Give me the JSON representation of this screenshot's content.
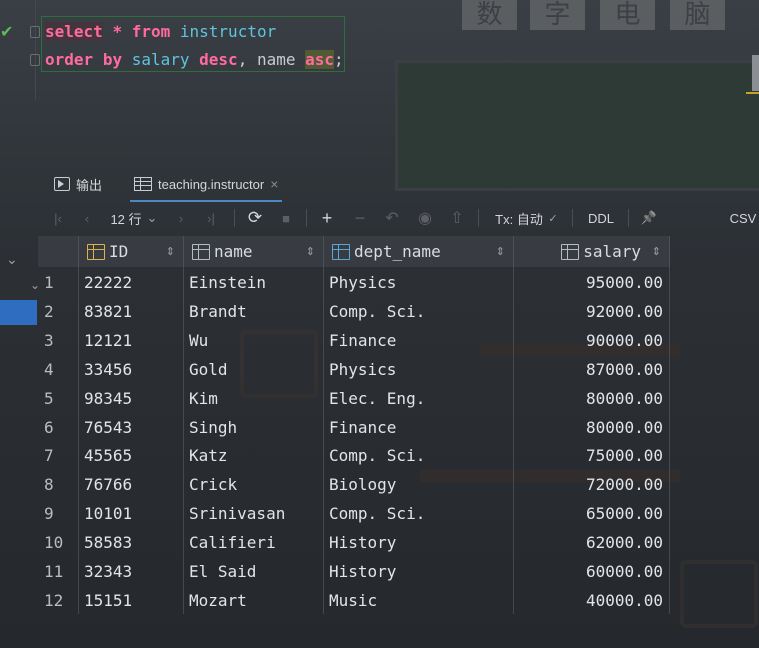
{
  "editor": {
    "line1": {
      "select": "select",
      "star": "*",
      "from": "from",
      "table": "instructor"
    },
    "line2": {
      "order": "order",
      "by": "by",
      "col1": "salary",
      "desc": "desc",
      "comma": ",",
      "col2": "name",
      "asc": "asc",
      "semi": ";"
    }
  },
  "tabs": [
    {
      "label": "输出",
      "icon": "run-output-icon"
    },
    {
      "label": "teaching.instructor",
      "icon": "table-grid-icon",
      "close": "×"
    }
  ],
  "toolbar": {
    "first": "|‹",
    "prev": "‹",
    "rows": "12 行",
    "rows_caret": "⌄",
    "next": "›",
    "last": "›|",
    "refresh": "⟳",
    "stop": "■",
    "add": "+",
    "remove": "−",
    "revert": "↶",
    "preview": "◉",
    "submit": "⇧",
    "tx": "Tx: 自动",
    "tx_caret": "✓",
    "ddl": "DDL",
    "pin": "📌",
    "csv": "CSV"
  },
  "table": {
    "columns": [
      {
        "name": "ID",
        "icon": "primary-key-icon"
      },
      {
        "name": "name",
        "icon": "column-icon"
      },
      {
        "name": "dept_name",
        "icon": "foreign-key-icon"
      },
      {
        "name": "salary",
        "icon": "column-icon"
      }
    ],
    "rows": [
      {
        "n": "1",
        "id": "22222",
        "name": "Einstein",
        "dept": "Physics",
        "salary": "95000.00"
      },
      {
        "n": "2",
        "id": "83821",
        "name": "Brandt",
        "dept": "Comp. Sci.",
        "salary": "92000.00"
      },
      {
        "n": "3",
        "id": "12121",
        "name": "Wu",
        "dept": "Finance",
        "salary": "90000.00"
      },
      {
        "n": "4",
        "id": "33456",
        "name": "Gold",
        "dept": "Physics",
        "salary": "87000.00"
      },
      {
        "n": "5",
        "id": "98345",
        "name": "Kim",
        "dept": "Elec. Eng.",
        "salary": "80000.00"
      },
      {
        "n": "6",
        "id": "76543",
        "name": "Singh",
        "dept": "Finance",
        "salary": "80000.00"
      },
      {
        "n": "7",
        "id": "45565",
        "name": "Katz",
        "dept": "Comp. Sci.",
        "salary": "75000.00"
      },
      {
        "n": "8",
        "id": "76766",
        "name": "Crick",
        "dept": "Biology",
        "salary": "72000.00"
      },
      {
        "n": "9",
        "id": "10101",
        "name": "Srinivasan",
        "dept": "Comp. Sci.",
        "salary": "65000.00"
      },
      {
        "n": "10",
        "id": "58583",
        "name": "Califieri",
        "dept": "History",
        "salary": "62000.00"
      },
      {
        "n": "11",
        "id": "32343",
        "name": "El Said",
        "dept": "History",
        "salary": "60000.00"
      },
      {
        "n": "12",
        "id": "15151",
        "name": "Mozart",
        "dept": "Music",
        "salary": "40000.00"
      }
    ]
  },
  "background": {
    "signs": [
      "数",
      "字",
      "电",
      "脑"
    ]
  },
  "colors": {
    "keyword": "#ff6b9e",
    "identifier": "#5fc4dd",
    "accent": "#4a88c7",
    "success": "#5fb760"
  }
}
